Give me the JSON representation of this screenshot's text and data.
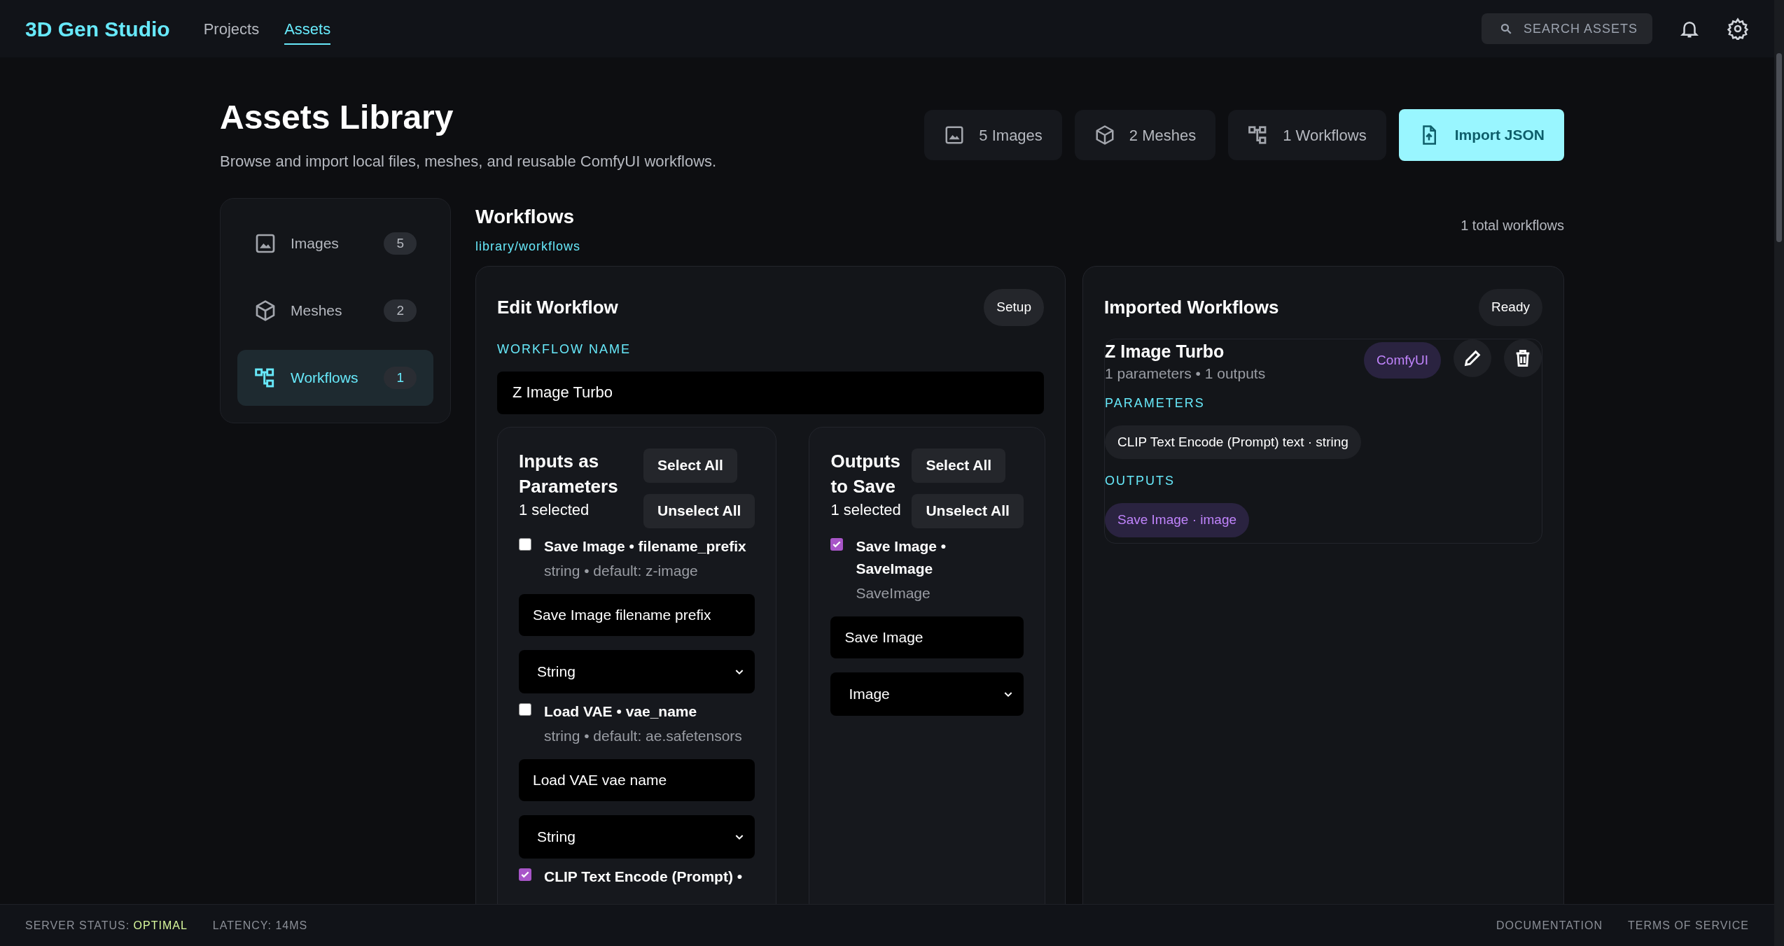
{
  "app": {
    "logo": "3D Gen Studio",
    "nav": [
      {
        "label": "Projects",
        "selected": false
      },
      {
        "label": "Assets",
        "selected": true
      }
    ],
    "search": {
      "placeholder": "SEARCH ASSETS"
    }
  },
  "header": {
    "title": "Assets Library",
    "subtitle": "Browse and import local files, meshes, and reusable ComfyUI workflows.",
    "stats": [
      {
        "kind": "image",
        "label": "5 Images"
      },
      {
        "kind": "mesh",
        "label": "2 Meshes"
      },
      {
        "kind": "workflow",
        "label": "1 Workflows"
      }
    ],
    "import_button": "Import JSON"
  },
  "sidebar": {
    "items": [
      {
        "kind": "image",
        "label": "Images",
        "count": "5",
        "selected": false
      },
      {
        "kind": "mesh",
        "label": "Meshes",
        "count": "2",
        "selected": false
      },
      {
        "kind": "workflow",
        "label": "Workflows",
        "count": "1",
        "selected": true
      }
    ]
  },
  "section": {
    "title": "Workflows",
    "path": "library/workflows",
    "total": "1 total workflows"
  },
  "editor": {
    "title": "Edit Workflow",
    "badge": "Setup",
    "name_label": "WORKFLOW NAME",
    "name_value": "Z Image Turbo",
    "inputs": {
      "title": "Inputs as Parameters",
      "count": "1 selected",
      "select_all": "Select All",
      "unselect_all": "Unselect All",
      "items": [
        {
          "label": "Save Image • filename_prefix",
          "detail": "string • default: z-image",
          "checked": false,
          "field_value": "Save Image filename prefix",
          "type_value": "String"
        },
        {
          "label": "Load VAE • vae_name",
          "detail": "string • default: ae.safetensors",
          "checked": false,
          "field_value": "Load VAE vae name",
          "type_value": "String"
        },
        {
          "label": "CLIP Text Encode (Prompt) •",
          "checked": true
        }
      ]
    },
    "outputs": {
      "title": "Outputs to Save",
      "count": "1 selected",
      "select_all": "Select All",
      "unselect_all": "Unselect All",
      "items": [
        {
          "label": "Save Image • SaveImage",
          "detail": "SaveImage",
          "checked": true,
          "field_value": "Save Image",
          "type_value": "Image"
        }
      ]
    }
  },
  "imported": {
    "title": "Imported Workflows",
    "status": "Ready",
    "workflows": [
      {
        "name": "Z Image Turbo",
        "summary": "1 parameters • 1 outputs",
        "source": "ComfyUI",
        "parameters_label": "PARAMETERS",
        "parameters": [
          "CLIP Text Encode (Prompt) text · string"
        ],
        "outputs_label": "OUTPUTS",
        "outputs": [
          "Save Image · image"
        ]
      }
    ]
  },
  "footer": {
    "status_label": "SERVER STATUS:",
    "status_value": "OPTIMAL",
    "latency": "LATENCY: 14MS",
    "links": [
      "DOCUMENTATION",
      "TERMS OF SERVICE"
    ]
  }
}
